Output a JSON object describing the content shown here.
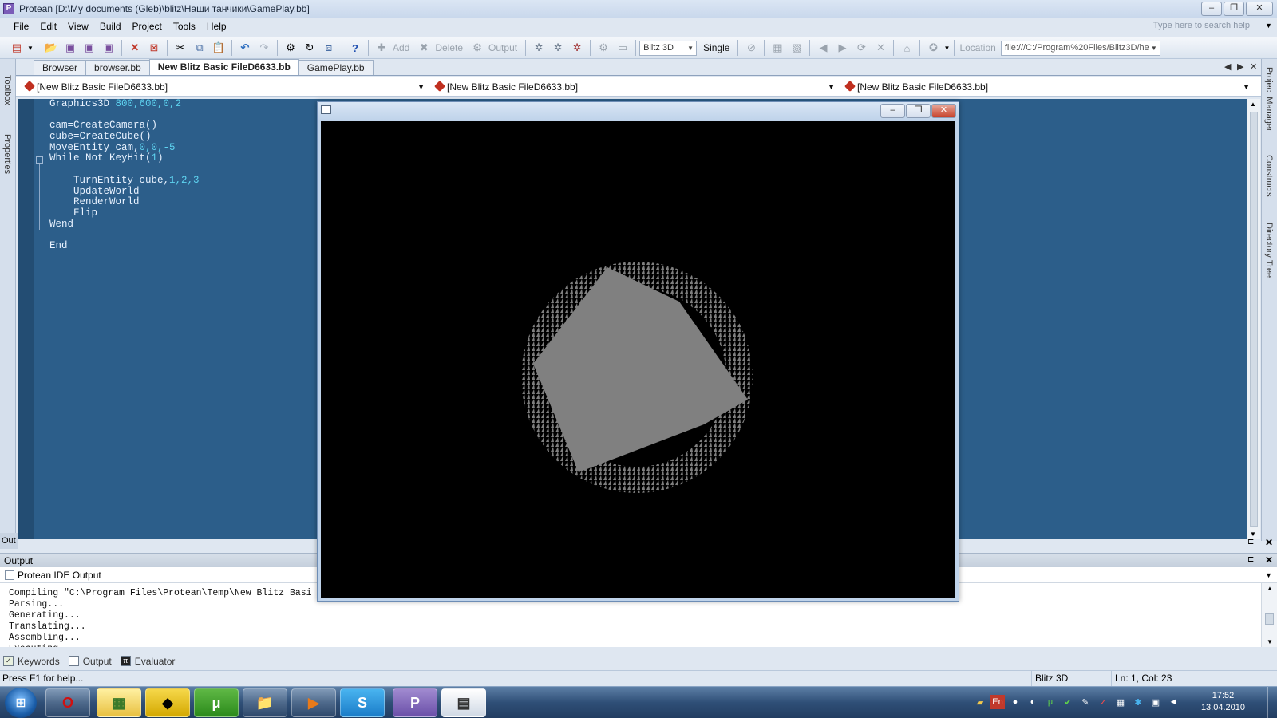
{
  "window": {
    "title": "Protean [D:\\My documents (Gleb)\\blitz\\Наши танчики\\GamePlay.bb]"
  },
  "menu": [
    "File",
    "Edit",
    "View",
    "Build",
    "Project",
    "Tools",
    "Help"
  ],
  "search_placeholder": "Type here to search help",
  "toolbar": {
    "add": "Add",
    "delete": "Delete",
    "output": "Output",
    "compiler": "Blitz 3D",
    "mode": "Single",
    "location_label": "Location",
    "location_value": "file:///C:/Program%20Files/Blitz3D/he"
  },
  "left_panels": [
    "Toolbox",
    "Properties"
  ],
  "right_panels": [
    "Project Manager",
    "Constructs",
    "Directory Tree"
  ],
  "tabs": [
    "Browser",
    "browser.bb",
    "New Blitz Basic FileD6633.bb",
    "GamePlay.bb"
  ],
  "function_bars": [
    "[New Blitz Basic FileD6633.bb]",
    "[New Blitz Basic FileD6633.bb]",
    "[New Blitz Basic FileD6633.bb]"
  ],
  "code_lines": [
    {
      "t": "Graphics3D ",
      "n": "800,600,0,2"
    },
    {
      "t": "",
      "n": ""
    },
    {
      "t": "cam=CreateCamera()",
      "n": ""
    },
    {
      "t": "cube=CreateCube()",
      "n": ""
    },
    {
      "t": "MoveEntity cam,",
      "n": "0,0,-5"
    },
    {
      "t": "While Not KeyHit(",
      "n": "1",
      "s": ")"
    },
    {
      "t": "",
      "n": ""
    },
    {
      "t": "    TurnEntity cube,",
      "n": "1,2,3"
    },
    {
      "t": "    UpdateWorld",
      "n": ""
    },
    {
      "t": "    RenderWorld",
      "n": ""
    },
    {
      "t": "    Flip",
      "n": ""
    },
    {
      "t": "Wend",
      "n": ""
    },
    {
      "t": "",
      "n": ""
    },
    {
      "t": "End",
      "n": ""
    }
  ],
  "output": {
    "header": "Output",
    "panel_title": "Protean IDE Output",
    "side_label": "Out",
    "lines": [
      "Compiling \"C:\\Program Files\\Protean\\Temp\\New Blitz Basi",
      "Parsing...",
      "Generating...",
      "Translating...",
      "Assembling...",
      "Executing..."
    ]
  },
  "bottom_tabs": [
    "Keywords",
    "Output",
    "Evaluator"
  ],
  "status": {
    "help": "Press F1 for help...",
    "compiler": "Blitz 3D",
    "position": "Ln: 1, Col: 23"
  },
  "clock": {
    "time": "17:52",
    "date": "13.04.2010"
  },
  "tray": {
    "lang": "En"
  },
  "colors": {
    "editor_bg": "#2c5e8a",
    "code_text": "#e8f2ff",
    "number": "#5ed3f0",
    "cube": "#808080"
  }
}
